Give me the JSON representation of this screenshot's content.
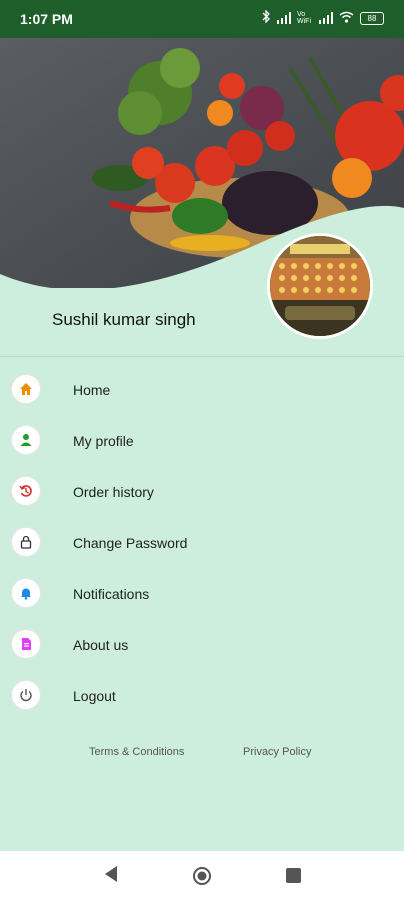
{
  "status": {
    "time": "1:07 PM",
    "network_label": "Vo WiFi",
    "battery_label": "88"
  },
  "profile": {
    "name": "Sushil kumar singh"
  },
  "menu": {
    "items": [
      {
        "label": "Home",
        "icon": "home-icon",
        "color": "#f08c00"
      },
      {
        "label": "My profile",
        "icon": "person-icon",
        "color": "#1aa02b"
      },
      {
        "label": "Order history",
        "icon": "history-icon",
        "color": "#d32f2f"
      },
      {
        "label": "Change Password",
        "icon": "lock-icon",
        "color": "#333333"
      },
      {
        "label": "Notifications",
        "icon": "bell-icon",
        "color": "#1e88e5"
      },
      {
        "label": "About us",
        "icon": "document-icon",
        "color": "#e040fb"
      },
      {
        "label": "Logout",
        "icon": "power-icon",
        "color": "#555555"
      }
    ]
  },
  "footer": {
    "terms": "Terms & Conditions",
    "privacy": "Privacy Policy"
  },
  "colors": {
    "statusbar": "#1e5e2a",
    "drawer_bg": "#cdeedd"
  }
}
